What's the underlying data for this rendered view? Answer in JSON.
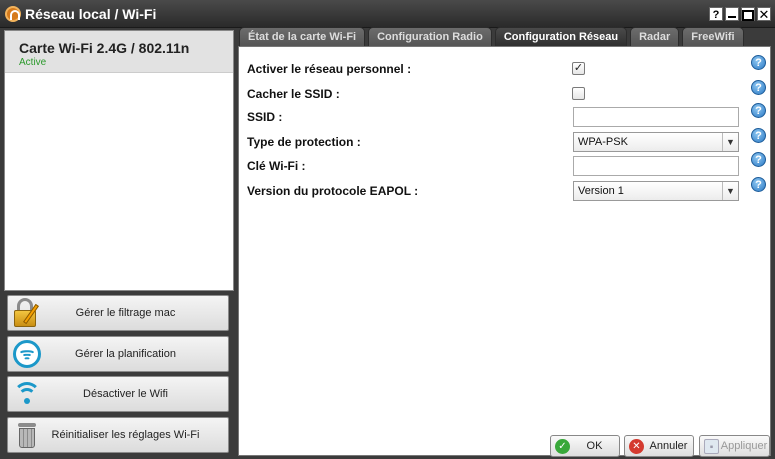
{
  "window": {
    "title": "Réseau local / Wi-Fi",
    "help_btn": "?",
    "close_btn": "✕"
  },
  "sidebar": {
    "card": {
      "name": "Carte Wi-Fi 2.4G / 802.11n",
      "status": "Active"
    },
    "actions": [
      {
        "label": "Gérer le filtrage mac",
        "icon": "lock-edit-icon"
      },
      {
        "label": "Gérer la planification",
        "icon": "schedule-icon"
      },
      {
        "label": "Désactiver le Wifi",
        "icon": "wifi-icon"
      },
      {
        "label": "Réinitialiser les réglages Wi-Fi",
        "icon": "trash-icon"
      }
    ]
  },
  "tabs": [
    {
      "label": "État de la carte Wi-Fi",
      "active": false
    },
    {
      "label": "Configuration Radio",
      "active": false
    },
    {
      "label": "Configuration Réseau",
      "active": true
    },
    {
      "label": "Radar",
      "active": false
    },
    {
      "label": "FreeWifi",
      "active": false
    }
  ],
  "form": {
    "enable_personal": {
      "label": "Activer le réseau personnel :",
      "checked": true,
      "mark": "✓"
    },
    "hide_ssid": {
      "label": "Cacher le SSID :",
      "checked": false
    },
    "ssid": {
      "label": "SSID :",
      "value": ""
    },
    "protection": {
      "label": "Type de protection :",
      "value": "WPA-PSK"
    },
    "wifi_key": {
      "label": "Clé Wi-Fi :",
      "value": ""
    },
    "eapol": {
      "label": "Version du protocole EAPOL :",
      "value": "Version 1"
    },
    "help": "?"
  },
  "footer": {
    "ok": "OK",
    "cancel": "Annuler",
    "apply": "Appliquer"
  },
  "colors": {
    "status_active": "#2c9a2c",
    "accent_blue": "#1c98c9",
    "ok_green": "#39a83a",
    "cancel_red": "#d43a2f"
  }
}
